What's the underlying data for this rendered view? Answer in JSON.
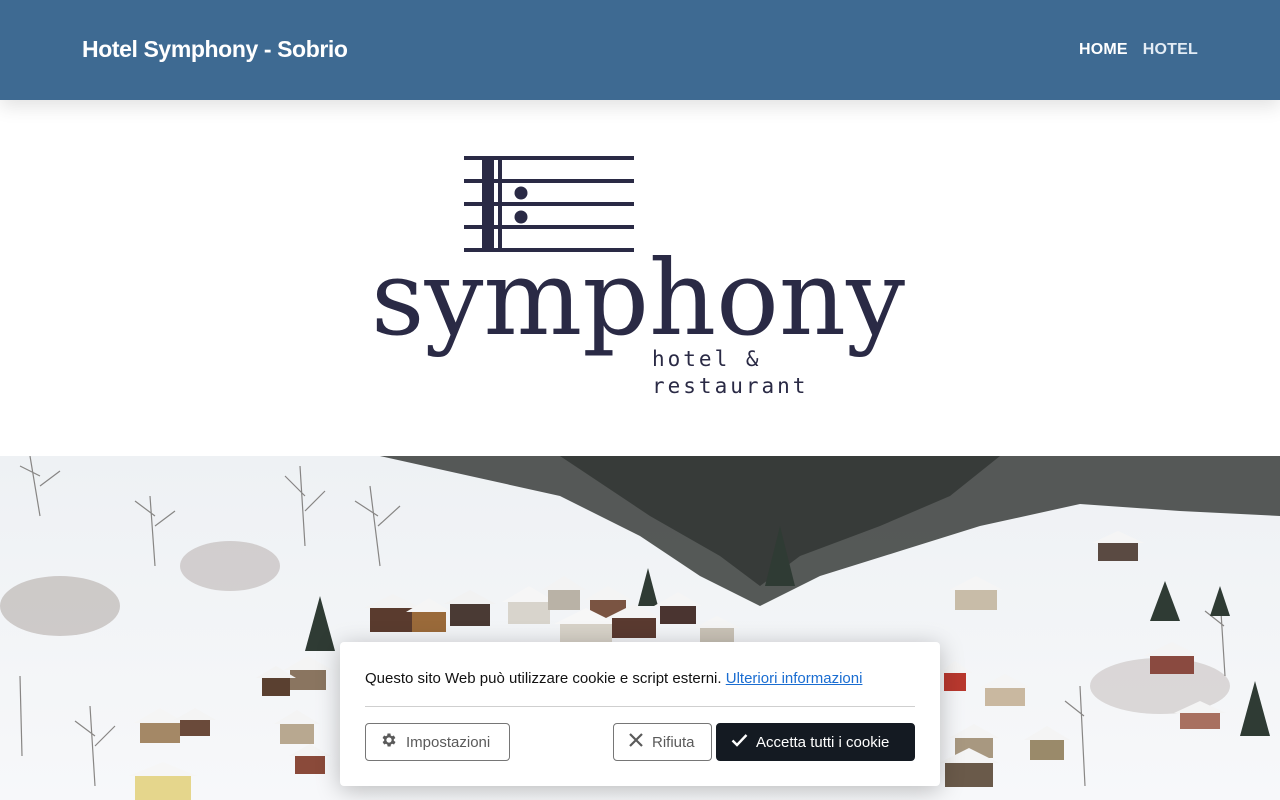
{
  "header": {
    "site_title": "Hotel Symphony - Sobrio",
    "nav": [
      {
        "label": "HOME"
      },
      {
        "label": "HOTEL"
      }
    ]
  },
  "logo": {
    "wordmark": "symphony",
    "line1": "hotel &",
    "line2": "restaurant"
  },
  "cookie_banner": {
    "message": "Questo sito Web può utilizzare cookie e script esterni.",
    "link_label": "Ulteriori informazioni",
    "settings_label": "Impostazioni",
    "reject_label": "Rifiuta",
    "accept_label": "Accetta tutti i cookie"
  },
  "colors": {
    "header_bg": "#3e6a92",
    "logo_ink": "#2a2a45",
    "accept_bg": "#141a22",
    "link": "#1a6dd1"
  },
  "icons": {
    "settings": "gear-icon",
    "reject": "close-icon",
    "accept": "checkmark-icon"
  }
}
